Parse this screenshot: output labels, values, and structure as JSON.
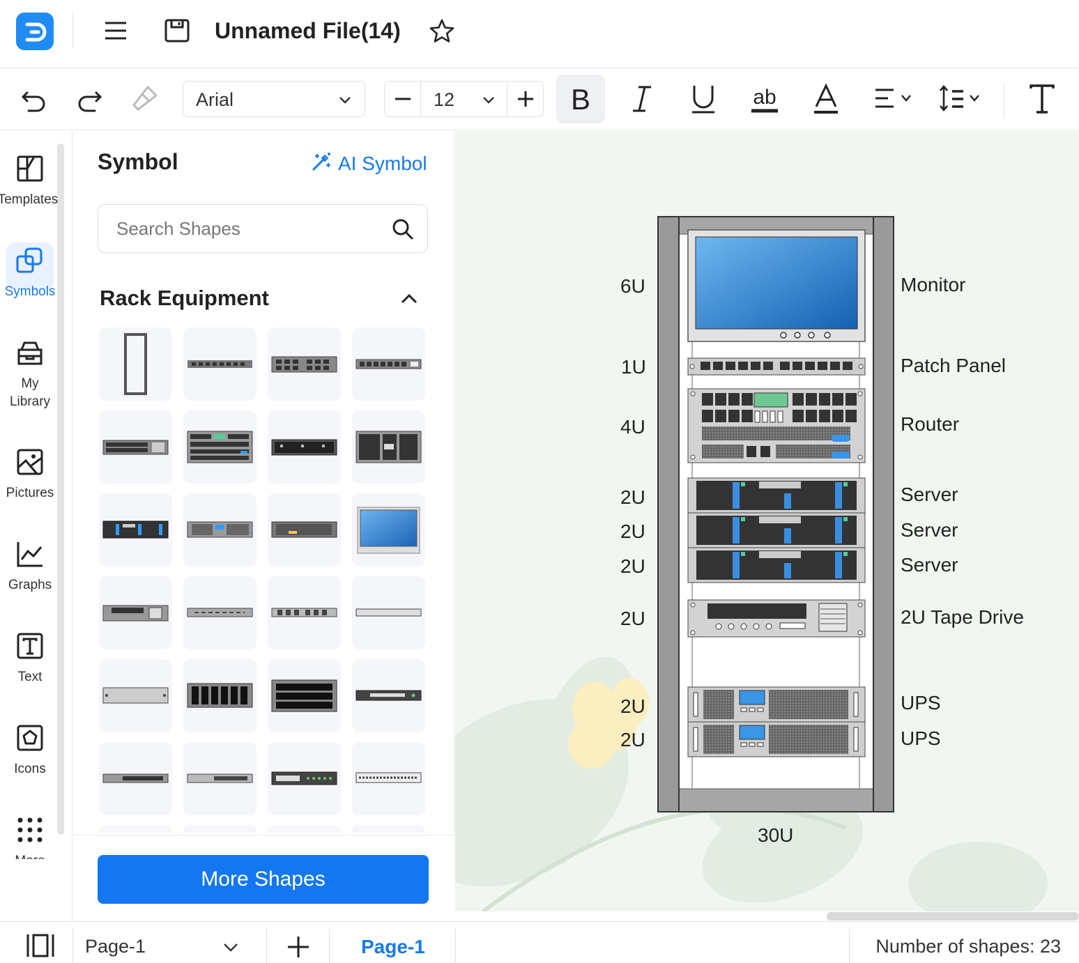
{
  "header": {
    "file_title": "Unnamed File(14)"
  },
  "toolbar": {
    "font_family": "Arial",
    "font_size": "12"
  },
  "rail": {
    "items": [
      {
        "label": "Templates",
        "icon": "templates-icon"
      },
      {
        "label": "Symbols",
        "icon": "symbols-icon",
        "active": true
      },
      {
        "label": "My Library",
        "icon": "my-library-icon"
      },
      {
        "label": "Pictures",
        "icon": "pictures-icon"
      },
      {
        "label": "Graphs",
        "icon": "graphs-icon"
      },
      {
        "label": "Text",
        "icon": "text-icon"
      },
      {
        "label": "Icons",
        "icon": "icons-icon"
      },
      {
        "label": "More",
        "icon": "more-icon"
      }
    ]
  },
  "panel": {
    "title": "Symbol",
    "ai_symbol": "AI Symbol",
    "search_placeholder": "Search Shapes",
    "category": "Rack Equipment",
    "more_shapes": "More Shapes"
  },
  "canvas": {
    "unit_labels": [
      "6U",
      "1U",
      "4U",
      "2U",
      "2U",
      "2U",
      "2U",
      "2U",
      "2U"
    ],
    "equipment_labels": [
      "Monitor",
      "Patch Panel",
      "Router",
      "Server",
      "Server",
      "Server",
      "2U Tape Drive",
      "UPS",
      "UPS"
    ],
    "rack_size": "30U"
  },
  "status": {
    "page_select": "Page-1",
    "page_tab": "Page-1",
    "shape_count": "Number of shapes: 23"
  },
  "colors": {
    "accent": "#1277f1",
    "canvas_bg": "#f1f6f1",
    "rack_frame": "#a9a9a9"
  }
}
